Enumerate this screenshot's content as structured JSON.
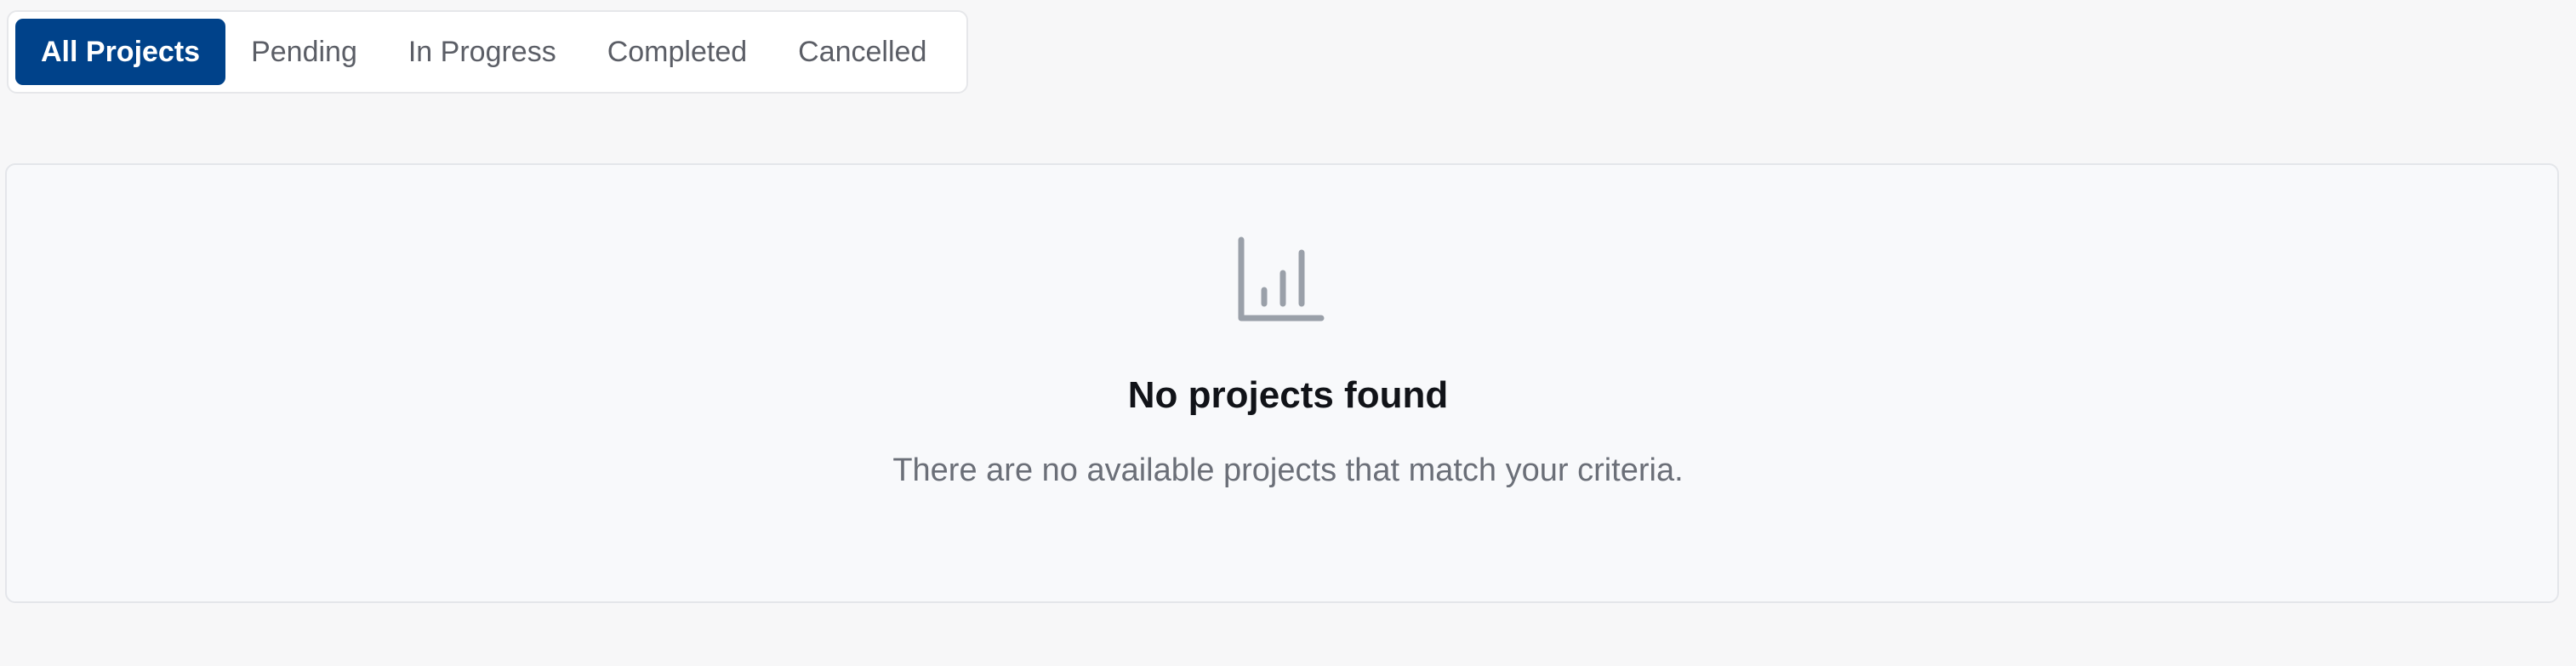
{
  "tabs": {
    "all": "All Projects",
    "pending": "Pending",
    "in_progress": "In Progress",
    "completed": "Completed",
    "cancelled": "Cancelled",
    "active": "All Projects"
  },
  "empty_state": {
    "icon": "bar-chart-icon",
    "title": "No projects found",
    "message": "There are no available projects that match your criteria."
  },
  "colors": {
    "accent": "#00428A",
    "background": "#F7F7F8",
    "card": "#F8F9FB",
    "icon": "#9AA0A9",
    "title": "#111318",
    "muted": "#6B6F78"
  }
}
